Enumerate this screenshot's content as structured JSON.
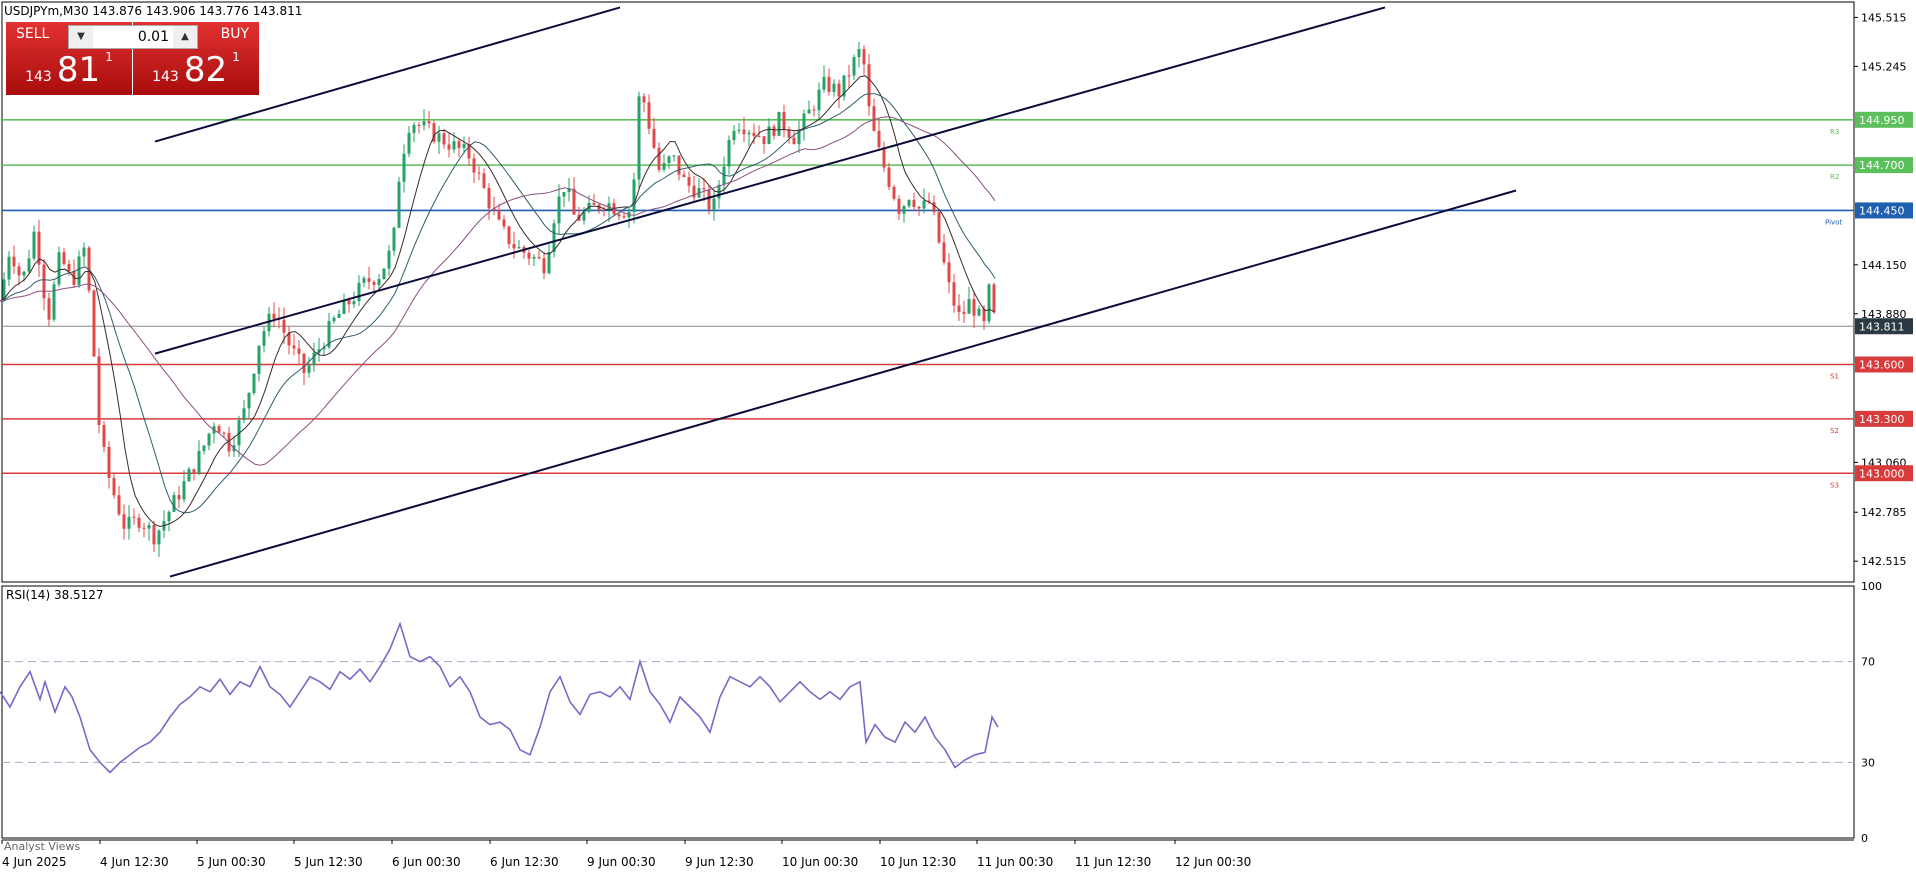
{
  "header": {
    "symbol_info": "USDJPYm,M30  143.876 143.906 143.776 143.811"
  },
  "trade_panel": {
    "sell_label": "SELL",
    "buy_label": "BUY",
    "lot_value": "0.01",
    "sell_price": {
      "prefix": "143",
      "big": "81",
      "sup": "1"
    },
    "buy_price": {
      "prefix": "143",
      "big": "82",
      "sup": "1"
    }
  },
  "chart_data": [
    {
      "type": "candlestick",
      "symbol": "USDJPYm",
      "timeframe": "M30",
      "ylim": [
        142.4,
        145.6
      ],
      "y_ticks": [
        "145.515",
        "145.245",
        "144.150",
        "143.880",
        "143.060",
        "142.785",
        "142.515"
      ],
      "x_ticks": [
        "4 Jun 2025",
        "4 Jun 12:30",
        "5 Jun 00:30",
        "5 Jun 12:30",
        "6 Jun 00:30",
        "6 Jun 12:30",
        "9 Jun 00:30",
        "9 Jun 12:30",
        "10 Jun 00:30",
        "10 Jun 12:30",
        "11 Jun 00:30",
        "11 Jun 12:30",
        "12 Jun 00:30"
      ],
      "close_path": [
        [
          0,
          143.95
        ],
        [
          10,
          144.25
        ],
        [
          22,
          144.05
        ],
        [
          35,
          144.35
        ],
        [
          48,
          143.85
        ],
        [
          60,
          144.2
        ],
        [
          72,
          144.05
        ],
        [
          85,
          144.25
        ],
        [
          92,
          143.8
        ],
        [
          100,
          143.2
        ],
        [
          110,
          142.95
        ],
        [
          125,
          142.7
        ],
        [
          140,
          142.75
        ],
        [
          155,
          142.65
        ],
        [
          170,
          142.8
        ],
        [
          185,
          142.95
        ],
        [
          200,
          143.1
        ],
        [
          215,
          143.3
        ],
        [
          230,
          143.15
        ],
        [
          245,
          143.35
        ],
        [
          260,
          143.75
        ],
        [
          275,
          143.9
        ],
        [
          290,
          143.7
        ],
        [
          305,
          143.55
        ],
        [
          320,
          143.7
        ],
        [
          335,
          143.85
        ],
        [
          350,
          143.95
        ],
        [
          365,
          144.05
        ],
        [
          380,
          144.1
        ],
        [
          393,
          144.25
        ],
        [
          400,
          144.7
        ],
        [
          410,
          144.95
        ],
        [
          425,
          144.9
        ],
        [
          440,
          144.85
        ],
        [
          455,
          144.8
        ],
        [
          470,
          144.75
        ],
        [
          485,
          144.55
        ],
        [
          500,
          144.35
        ],
        [
          515,
          144.25
        ],
        [
          530,
          144.2
        ],
        [
          545,
          144.15
        ],
        [
          555,
          144.45
        ],
        [
          565,
          144.6
        ],
        [
          575,
          144.4
        ],
        [
          590,
          144.45
        ],
        [
          605,
          144.5
        ],
        [
          620,
          144.45
        ],
        [
          632,
          144.45
        ],
        [
          640,
          145.15
        ],
        [
          650,
          144.9
        ],
        [
          660,
          144.65
        ],
        [
          672,
          144.75
        ],
        [
          685,
          144.6
        ],
        [
          700,
          144.55
        ],
        [
          713,
          144.45
        ],
        [
          725,
          144.75
        ],
        [
          735,
          144.95
        ],
        [
          750,
          144.9
        ],
        [
          765,
          144.85
        ],
        [
          780,
          144.95
        ],
        [
          795,
          144.85
        ],
        [
          810,
          145.0
        ],
        [
          825,
          145.15
        ],
        [
          840,
          145.1
        ],
        [
          852,
          145.25
        ],
        [
          862,
          145.35
        ],
        [
          870,
          144.95
        ],
        [
          880,
          144.75
        ],
        [
          890,
          144.6
        ],
        [
          900,
          144.45
        ],
        [
          910,
          144.55
        ],
        [
          920,
          144.45
        ],
        [
          930,
          144.5
        ],
        [
          940,
          144.25
        ],
        [
          950,
          144.0
        ],
        [
          960,
          143.85
        ],
        [
          970,
          143.95
        ],
        [
          980,
          143.85
        ],
        [
          985,
          143.8
        ],
        [
          990,
          144.05
        ],
        [
          995,
          143.81
        ]
      ],
      "levels": [
        {
          "label": "144.950",
          "tag": "R3",
          "value": 144.95,
          "color": "#5bbf5b"
        },
        {
          "label": "144.700",
          "tag": "R2",
          "value": 144.7,
          "color": "#5bbf5b"
        },
        {
          "label": "144.450",
          "tag": "Pivot",
          "value": 144.45,
          "color": "#1f5fb0"
        },
        {
          "label": "143.811",
          "tag": "",
          "value": 143.811,
          "color": "#888888"
        },
        {
          "label": "143.600",
          "tag": "S1",
          "value": 143.6,
          "color": "#d83b3b"
        },
        {
          "label": "143.300",
          "tag": "S2",
          "value": 143.3,
          "color": "#d83b3b"
        },
        {
          "label": "143.000",
          "tag": "S3",
          "value": 143.0,
          "color": "#d83b3b"
        }
      ],
      "channel_lines": [
        {
          "from": [
            155,
            144.83
          ],
          "to": [
            620,
            145.57
          ]
        },
        {
          "from": [
            155,
            143.66
          ],
          "to": [
            1385,
            145.57
          ]
        },
        {
          "from": [
            170,
            142.43
          ],
          "to": [
            1516,
            144.56
          ]
        }
      ],
      "colors": {
        "bull": "#26a269",
        "bear": "#e0494a",
        "axis": "#000000"
      }
    },
    {
      "type": "line",
      "title": "RSI(14) 38.5127",
      "ylim": [
        0,
        100
      ],
      "y_ticks": [
        "100",
        "70",
        "30",
        "0"
      ],
      "levels": [
        70,
        30
      ],
      "values": [
        [
          0,
          58
        ],
        [
          10,
          52
        ],
        [
          20,
          60
        ],
        [
          30,
          66
        ],
        [
          40,
          55
        ],
        [
          45,
          62
        ],
        [
          55,
          50
        ],
        [
          65,
          60
        ],
        [
          72,
          56
        ],
        [
          80,
          48
        ],
        [
          90,
          35
        ],
        [
          100,
          30
        ],
        [
          110,
          26
        ],
        [
          120,
          30
        ],
        [
          130,
          33
        ],
        [
          140,
          36
        ],
        [
          150,
          38
        ],
        [
          160,
          42
        ],
        [
          170,
          48
        ],
        [
          180,
          53
        ],
        [
          190,
          56
        ],
        [
          200,
          60
        ],
        [
          210,
          58
        ],
        [
          220,
          63
        ],
        [
          230,
          57
        ],
        [
          240,
          62
        ],
        [
          250,
          60
        ],
        [
          260,
          68
        ],
        [
          270,
          60
        ],
        [
          280,
          57
        ],
        [
          290,
          52
        ],
        [
          300,
          58
        ],
        [
          310,
          64
        ],
        [
          320,
          62
        ],
        [
          330,
          59
        ],
        [
          340,
          66
        ],
        [
          350,
          63
        ],
        [
          360,
          67
        ],
        [
          370,
          62
        ],
        [
          380,
          68
        ],
        [
          390,
          75
        ],
        [
          400,
          85
        ],
        [
          410,
          72
        ],
        [
          420,
          70
        ],
        [
          430,
          72
        ],
        [
          440,
          68
        ],
        [
          450,
          60
        ],
        [
          460,
          64
        ],
        [
          470,
          58
        ],
        [
          480,
          48
        ],
        [
          490,
          45
        ],
        [
          500,
          46
        ],
        [
          510,
          43
        ],
        [
          520,
          35
        ],
        [
          530,
          33
        ],
        [
          540,
          44
        ],
        [
          550,
          58
        ],
        [
          560,
          64
        ],
        [
          570,
          54
        ],
        [
          580,
          49
        ],
        [
          590,
          57
        ],
        [
          600,
          58
        ],
        [
          610,
          56
        ],
        [
          620,
          60
        ],
        [
          630,
          55
        ],
        [
          640,
          70
        ],
        [
          650,
          58
        ],
        [
          660,
          53
        ],
        [
          670,
          46
        ],
        [
          680,
          56
        ],
        [
          690,
          52
        ],
        [
          700,
          48
        ],
        [
          710,
          42
        ],
        [
          720,
          56
        ],
        [
          730,
          64
        ],
        [
          740,
          62
        ],
        [
          750,
          60
        ],
        [
          760,
          64
        ],
        [
          770,
          60
        ],
        [
          780,
          54
        ],
        [
          790,
          58
        ],
        [
          800,
          62
        ],
        [
          810,
          58
        ],
        [
          820,
          55
        ],
        [
          830,
          58
        ],
        [
          840,
          55
        ],
        [
          850,
          60
        ],
        [
          860,
          62
        ],
        [
          866,
          38
        ],
        [
          875,
          45
        ],
        [
          885,
          40
        ],
        [
          895,
          38
        ],
        [
          905,
          46
        ],
        [
          915,
          42
        ],
        [
          925,
          48
        ],
        [
          935,
          40
        ],
        [
          945,
          35
        ],
        [
          955,
          28
        ],
        [
          965,
          31
        ],
        [
          975,
          33
        ],
        [
          985,
          34
        ],
        [
          992,
          48
        ],
        [
          998,
          44
        ]
      ],
      "line_color": "#7b68c6"
    }
  ]
}
